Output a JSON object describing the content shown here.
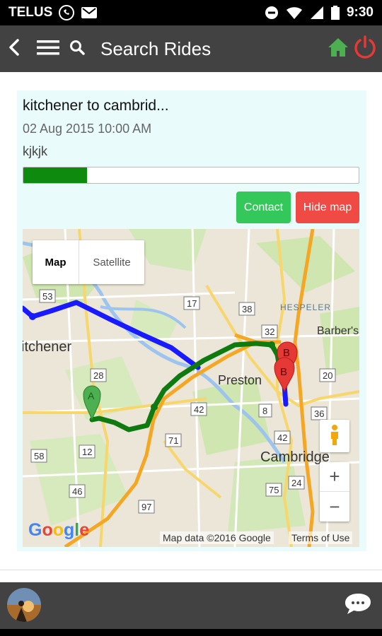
{
  "status_bar": {
    "carrier": "TELUS",
    "time": "9:30"
  },
  "app_bar": {
    "title": "Search Rides"
  },
  "ride": {
    "title": "kitchener to cambrid...",
    "datetime": "02 Aug 2015 10:00 AM",
    "note": "kjkjk",
    "progress_percent": 19,
    "contact_label": "Contact",
    "hide_map_label": "Hide map"
  },
  "map": {
    "map_type_map": "Map",
    "map_type_satellite": "Satellite",
    "place_labels": [
      "itchener",
      "Preston",
      "Cambridge",
      "HESPELER",
      "Barber's"
    ],
    "road_labels": [
      "53",
      "17",
      "38",
      "32",
      "28",
      "42",
      "8",
      "36",
      "20",
      "12",
      "71",
      "42",
      "58",
      "46",
      "75",
      "24",
      "97"
    ],
    "marker_a": "A",
    "marker_b": "B",
    "zoom_in": "+",
    "zoom_out": "−",
    "logo": "Google",
    "attribution": "Map data ©2016 Google",
    "terms": "Terms of Use",
    "colors": {
      "route_blue": "#1a1aff",
      "route_green": "#0f7a0f",
      "highway_orange": "#f5a623",
      "marker_a": "#4caf50",
      "marker_b": "#e53935"
    }
  },
  "colors": {
    "appbar": "#424242",
    "card_bg": "#e9fbfb",
    "progress_fill": "#0e8a0e",
    "contact_button": "#34c759",
    "hide_map_button": "#ef4b44",
    "home_icon": "#4caf50",
    "power_icon": "#e53935"
  }
}
